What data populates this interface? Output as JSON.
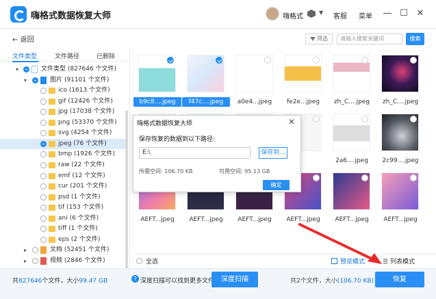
{
  "app": {
    "title": "嗨格式数据恢复大师",
    "username": "嗨格式",
    "service": "客服",
    "menu": "菜单",
    "min": "—",
    "max": "☐",
    "close": "✕"
  },
  "toolbar": {
    "back": "返回",
    "filter": "筛选",
    "search_placeholder": "请输入搜索关键词",
    "search_button": "搜索"
  },
  "tabs": [
    "文件类型",
    "文件路径",
    "已删除"
  ],
  "tree": [
    {
      "label": "文件类型 (827646 个文件)"
    },
    {
      "label": "图片 (91101 个文件)"
    },
    {
      "label": "ico (1613 个文件)"
    },
    {
      "label": "gif (12426 个文件)"
    },
    {
      "label": "jpg (17038 个文件)"
    },
    {
      "label": "png (53370 个文件)"
    },
    {
      "label": "svg (4254 个文件)"
    },
    {
      "label": "jpeg (76 个文件)"
    },
    {
      "label": "bmp (1926 个文件)"
    },
    {
      "label": "raw (22 个文件)"
    },
    {
      "label": "emf (12 个文件)"
    },
    {
      "label": "cur (201 个文件)"
    },
    {
      "label": "psd (1 个文件)"
    },
    {
      "label": "tif (153 个文件)"
    },
    {
      "label": "ani (6 个文件)"
    },
    {
      "label": "tiff (1 个文件)"
    },
    {
      "label": "eps (2 个文件)"
    },
    {
      "label": "文档 (52451 个文件)"
    },
    {
      "label": "视频 (2846 个文件)"
    }
  ],
  "files": [
    {
      "name": "b9c8....jpeg",
      "selected": true
    },
    {
      "name": "f47c....jpeg",
      "selected": true
    },
    {
      "name": "a0e4...jpeg",
      "selected": false
    },
    {
      "name": "fe2e...jpeg",
      "selected": false
    },
    {
      "name": "zh_C....jpeg",
      "selected": false
    },
    {
      "name": "zh_C....jpeg",
      "selected": false
    },
    {
      "name": "",
      "selected": false
    },
    {
      "name": "",
      "selected": false
    },
    {
      "name": "",
      "selected": false
    },
    {
      "name": "",
      "selected": false
    },
    {
      "name": "2a6....jpeg",
      "selected": false
    },
    {
      "name": "2c99....jpeg",
      "selected": false
    },
    {
      "name": "AEFT...jpeg",
      "selected": false
    },
    {
      "name": "AEFT...jpeg",
      "selected": false
    },
    {
      "name": "AEFT...jpeg",
      "selected": false
    },
    {
      "name": "AEFT...jpeg",
      "selected": false
    },
    {
      "name": "AEFT...jpeg",
      "selected": false
    },
    {
      "name": "AEFT...jpeg",
      "selected": false
    }
  ],
  "dialog": {
    "title": "嗨格式数据恢复大师",
    "close": "✕",
    "label": "保存恢复的数据到以下路径:",
    "path": "E:\\",
    "browse": "保存到...",
    "needed": "所需空间: 106.70 KB",
    "available": "可用空间: 95.13 GB",
    "ok": "确定"
  },
  "view": {
    "select_all": "全选",
    "preview": "预览模式",
    "list": "列表模式"
  },
  "footer": {
    "count_prefix": "共",
    "count": "827646",
    "count_mid": "个文件，大小",
    "size": "99.47 GB",
    "tip": "深度扫描可以找到更多文件",
    "deep_scan": "深度扫描",
    "selected_prefix": "共2个文件，大小",
    "selected_size": "(106.70 KB)",
    "recover": "恢复",
    "q": "?"
  },
  "colors": {
    "accent": "#2a8ff5",
    "arrow": "#e82c2c"
  }
}
